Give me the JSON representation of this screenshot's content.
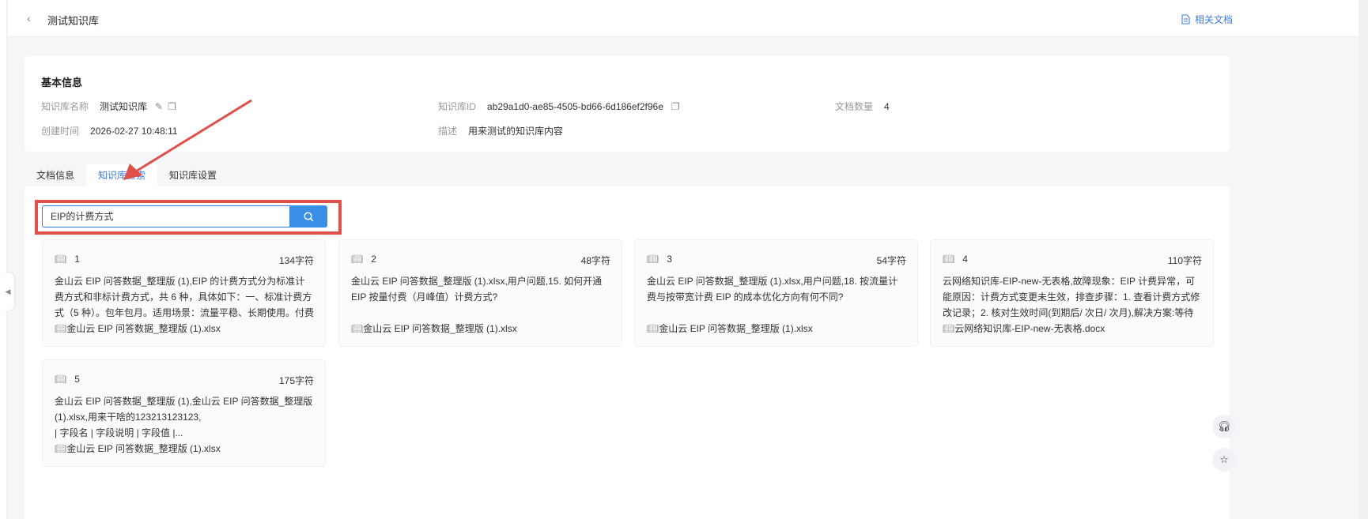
{
  "header": {
    "title": "测试知识库",
    "related_docs": "相关文档"
  },
  "info": {
    "heading": "基本信息",
    "name_label": "知识库名称",
    "name_value": "测试知识库",
    "id_label": "知识库ID",
    "id_value": "ab29a1d0-ae85-4505-bd66-6d186ef2f96e",
    "count_label": "文档数量",
    "count_value": "4",
    "created_label": "创建时间",
    "created_value": "2026-02-27 10:48:11",
    "desc_label": "描述",
    "desc_value": "用来测试的知识库内容"
  },
  "tabs": [
    {
      "label": "文档信息"
    },
    {
      "label": "知识库检索"
    },
    {
      "label": "知识库设置"
    }
  ],
  "search": {
    "value": "EIP的计费方式"
  },
  "results": [
    {
      "index": "1",
      "chars": "134字符",
      "text": "金山云 EIP 问答数据_整理版 (1),EIP 的计费方式分为标准计费方式和非标计费方式，共 6 种，具体如下：一、标准计费方式（5 种）。包年包月。适用场景：流量平稳、长期使用。付费模式：预付费。...",
      "source": "金山云 EIP 问答数据_整理版 (1).xlsx"
    },
    {
      "index": "2",
      "chars": "48字符",
      "text": "金山云 EIP 问答数据_整理版 (1).xlsx,用户问题,15. 如何开通 EIP 按量付费（月峰值）计费方式?",
      "source": "金山云 EIP 问答数据_整理版 (1).xlsx"
    },
    {
      "index": "3",
      "chars": "54字符",
      "text": "金山云 EIP 问答数据_整理版 (1).xlsx,用户问题,18. 按流量计费与按带宽计费 EIP 的成本优化方向有何不同?",
      "source": "金山云 EIP 问答数据_整理版 (1).xlsx"
    },
    {
      "index": "4",
      "chars": "110字符",
      "text": "云网络知识库-EIP-new-无表格,故障现象：EIP 计费异常，可能原因：计费方式变更未生效，排查步骤：1. 查看计费方式修改记录；2. 核对生效时间(到期后/ 次日/ 次月),解决方案:等待生效时间到达;若...",
      "source": "云网络知识库-EIP-new-无表格.docx"
    },
    {
      "index": "5",
      "chars": "175字符",
      "text": "金山云 EIP 问答数据_整理版 (1),金山云 EIP 问答数据_整理版 (1).xlsx,用来干啥的123213123123,\n| 字段名 | 字段说明 | 字段值 |...",
      "source": "金山云 EIP 问答数据_整理版 (1).xlsx"
    }
  ],
  "colors": {
    "accent": "#3a7be0",
    "annotation": "#e0504a"
  }
}
